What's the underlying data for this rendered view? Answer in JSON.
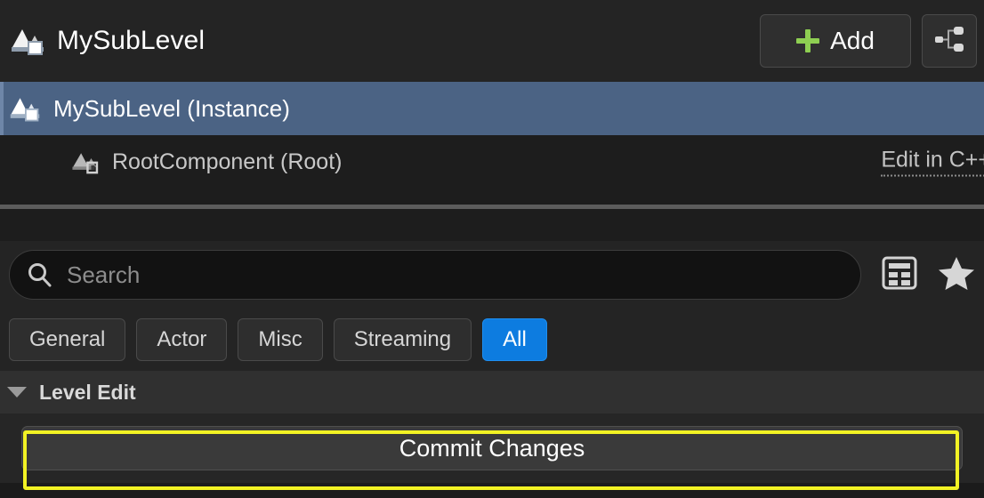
{
  "header": {
    "icon": "level-instance-icon",
    "title": "MySubLevel",
    "add_label": "Add",
    "add_icon": "plus-icon",
    "tree_view_icon": "component-hierarchy-icon"
  },
  "component_tree": {
    "rows": [
      {
        "icon": "level-instance-icon",
        "label": "MySubLevel (Instance)",
        "selected": true,
        "link": null
      },
      {
        "icon": "root-component-icon",
        "label": "RootComponent (Root)",
        "selected": false,
        "link": "Edit in C++"
      }
    ]
  },
  "search": {
    "icon": "search-icon",
    "placeholder": "Search",
    "value": "",
    "column_view_icon": "table-view-icon",
    "favorites_icon": "star-icon"
  },
  "filter_tabs": [
    {
      "label": "General",
      "active": false
    },
    {
      "label": "Actor",
      "active": false
    },
    {
      "label": "Misc",
      "active": false
    },
    {
      "label": "Streaming",
      "active": false
    },
    {
      "label": "All",
      "active": true
    }
  ],
  "categories": [
    {
      "title": "Level Edit",
      "expanded": true,
      "caret_icon": "chevron-down-icon",
      "properties": [
        {
          "type": "button",
          "label": "Commit Changes",
          "highlighted": true
        }
      ]
    }
  ],
  "colors": {
    "accent_blue": "#0d7ce0",
    "selection_blue": "#4b6384",
    "add_plus_green": "#8ecf52",
    "highlight_yellow": "#f2f224",
    "panel_bg": "#242424",
    "tree_bg": "#1d1d1d",
    "details_bg": "#262626"
  }
}
